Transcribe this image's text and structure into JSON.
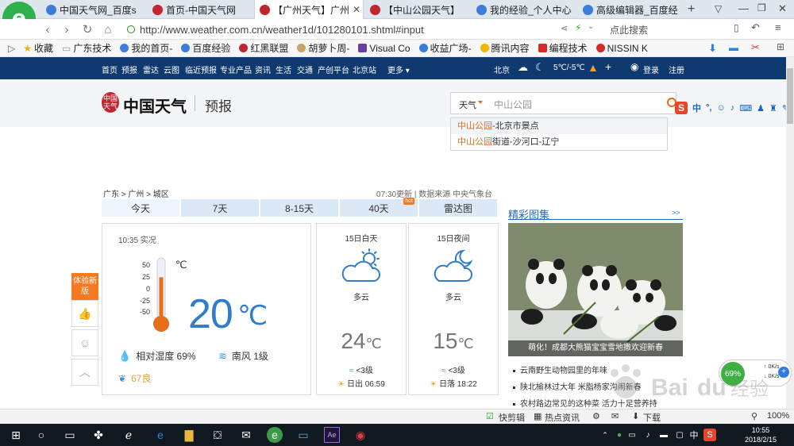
{
  "browser": {
    "tabs": [
      {
        "title": "中国天气网_百度s",
        "icon": "baidu-paw-icon"
      },
      {
        "title": "首页-中国天气网",
        "icon": "weather-logo-icon"
      },
      {
        "title": "【广州天气】广州",
        "icon": "weather-logo-icon",
        "active": true
      },
      {
        "title": "【中山公园天气】",
        "icon": "weather-logo-icon"
      },
      {
        "title": "我的经验_个人中心",
        "icon": "baidu-paw-icon"
      },
      {
        "title": "高级编辑器_百度经",
        "icon": "baidu-paw-icon"
      }
    ],
    "url": "http://www.weather.com.cn/weather1d/101280101.shtml#input",
    "search_placeholder": "点此搜索",
    "bookmarks": [
      {
        "label": "收藏",
        "icon": "star-icon"
      },
      {
        "label": "广东技术",
        "icon": "folder-icon"
      },
      {
        "label": "我的首页-",
        "icon": "baidu-paw-icon"
      },
      {
        "label": "百度经验",
        "icon": "baidu-paw-icon"
      },
      {
        "label": "红黑联盟",
        "icon": "shield-icon"
      },
      {
        "label": "胡萝卜周-",
        "icon": "carrot-icon"
      },
      {
        "label": "Visual Co",
        "icon": "vs-icon"
      },
      {
        "label": "收益广场-",
        "icon": "baidu-paw-icon"
      },
      {
        "label": "腾讯内容",
        "icon": "qq-icon"
      },
      {
        "label": "编程技术",
        "icon": "c-icon"
      },
      {
        "label": "NISSIN K",
        "icon": "nissin-icon"
      }
    ]
  },
  "site_nav": {
    "items": [
      "首页",
      "预报",
      "雷达",
      "云图",
      "临近预报",
      "专业产品",
      "资讯",
      "生活",
      "交通",
      "产创平台",
      "北京站",
      "更多"
    ],
    "city": "北京",
    "weather_range": "5℃/-5℃",
    "login": "登录",
    "register": "注册"
  },
  "header": {
    "brand_icon_text": "中国天气",
    "brand": "中国天气",
    "section": "预报",
    "search_category": "天气",
    "search_value": "中山公园",
    "suggestions": [
      {
        "hl": "中山公园",
        "rest": "-北京市景点"
      },
      {
        "hl": "中山公园",
        "rest": "街道-沙河口-辽宁"
      }
    ]
  },
  "ime_toolbar": {
    "label": "中"
  },
  "location": {
    "breadcrumb": "广东 > 广州 > 城区",
    "update": "07:30更新 | 数据来源 中央气象台"
  },
  "weather_tabs": [
    {
      "label": "今天",
      "active": true
    },
    {
      "label": "7天"
    },
    {
      "label": "8-15天"
    },
    {
      "label": "40天",
      "badge": "hot"
    },
    {
      "label": "雷达图"
    }
  ],
  "now": {
    "time": "10:35 实况",
    "scale": [
      "50",
      "25",
      "0",
      "-25",
      "-50"
    ],
    "temp": "20",
    "unit": "℃",
    "humidity": "相对湿度  69%",
    "wind": "南风  1级",
    "aqi": "67良",
    "thermo_fill": 0.7
  },
  "forecast": [
    {
      "title": "15日白天",
      "desc": "多云",
      "temp": "24",
      "unit": "℃",
      "wind": "<3级",
      "sun": "日出 06:59",
      "icon": "partly-cloudy-day-icon"
    },
    {
      "title": "15日夜间",
      "desc": "多云",
      "temp": "15",
      "unit": "℃",
      "wind": "<3级",
      "sun": "日落 18:22",
      "icon": "partly-cloudy-night-icon"
    }
  ],
  "gallery": {
    "title": "精彩图集",
    "more": ">>",
    "caption": "萌化！成都大熊猫宝宝雪地撒欢迎新春",
    "news": [
      "云南野生动物园里的年味",
      "陕北榆林过大年 米脂杨家沟闹新春",
      "农村路边常见的这种菜 活力十足营养持"
    ]
  },
  "feedback": {
    "new_label": "体验新版"
  },
  "statusbar": {
    "clip": "快剪辑",
    "hot": "热点资讯",
    "download": "下载",
    "zoom": "100%"
  },
  "netspeed": {
    "percent": "69%",
    "up": "0K/s",
    "down": "0K/s"
  },
  "watermark": "Baidu经验",
  "clock": {
    "time": "10:55",
    "date": "2018/2/15"
  },
  "taskbar_lang": "中",
  "colors": {
    "nav_bg": "#0e3a70",
    "accent": "#e76b1d",
    "temp_blue": "#2f7dcb",
    "tab_bg": "#dbe9f7"
  }
}
